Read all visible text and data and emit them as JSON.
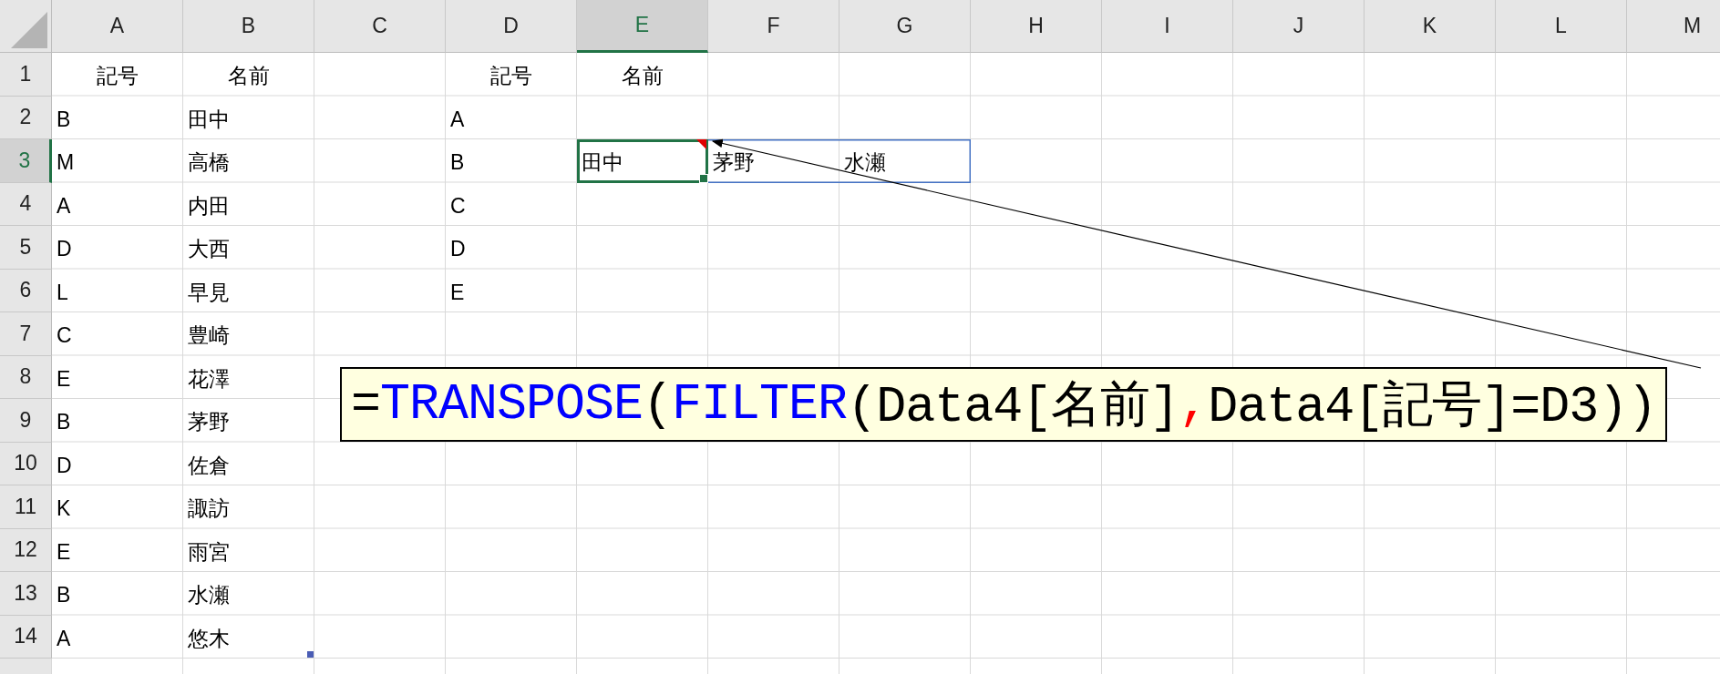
{
  "columns": [
    {
      "label": "A",
      "selected": false
    },
    {
      "label": "B",
      "selected": false
    },
    {
      "label": "C",
      "selected": false
    },
    {
      "label": "D",
      "selected": false
    },
    {
      "label": "E",
      "selected": true
    },
    {
      "label": "F",
      "selected": false
    },
    {
      "label": "G",
      "selected": false
    },
    {
      "label": "H",
      "selected": false
    },
    {
      "label": "I",
      "selected": false
    },
    {
      "label": "J",
      "selected": false
    },
    {
      "label": "K",
      "selected": false
    },
    {
      "label": "L",
      "selected": false
    },
    {
      "label": "M",
      "selected": false
    }
  ],
  "rows": [
    {
      "label": "1",
      "selected": false,
      "cells": [
        {
          "text": "記号",
          "centered": true,
          "selected": false
        },
        {
          "text": "名前",
          "centered": true,
          "selected": false
        },
        null,
        {
          "text": "記号",
          "centered": true,
          "selected": false
        },
        {
          "text": "名前",
          "centered": true,
          "selected": false
        }
      ]
    },
    {
      "label": "2",
      "selected": false,
      "cells": [
        {
          "text": "B",
          "selected": false
        },
        {
          "text": "田中",
          "selected": false
        },
        null,
        {
          "text": "A",
          "selected": false
        }
      ]
    },
    {
      "label": "3",
      "selected": true,
      "cells": [
        {
          "text": "M",
          "selected": false
        },
        {
          "text": "高橋",
          "selected": false
        },
        null,
        {
          "text": "B",
          "selected": false
        },
        {
          "text": "田中",
          "selected": true,
          "comment": true
        },
        {
          "text": "茅野",
          "selected": false,
          "spill": true
        },
        {
          "text": "水瀬",
          "selected": false,
          "spill": true
        }
      ]
    },
    {
      "label": "4",
      "selected": false,
      "cells": [
        {
          "text": "A",
          "selected": false
        },
        {
          "text": "内田",
          "selected": false
        },
        null,
        {
          "text": "C",
          "selected": false
        }
      ]
    },
    {
      "label": "5",
      "selected": false,
      "cells": [
        {
          "text": "D",
          "selected": false
        },
        {
          "text": "大西",
          "selected": false
        },
        null,
        {
          "text": "D",
          "selected": false
        }
      ]
    },
    {
      "label": "6",
      "selected": false,
      "cells": [
        {
          "text": "L",
          "selected": false
        },
        {
          "text": "早見",
          "selected": false
        },
        null,
        {
          "text": "E",
          "selected": false
        }
      ]
    },
    {
      "label": "7",
      "selected": false,
      "cells": [
        {
          "text": "C",
          "selected": false
        },
        {
          "text": "豊崎",
          "selected": false
        }
      ]
    },
    {
      "label": "8",
      "selected": false,
      "cells": [
        {
          "text": "E",
          "selected": false
        },
        {
          "text": "花澤",
          "selected": false
        }
      ]
    },
    {
      "label": "9",
      "selected": false,
      "cells": [
        {
          "text": "B",
          "selected": false
        },
        {
          "text": "茅野",
          "selected": false
        }
      ]
    },
    {
      "label": "10",
      "selected": false,
      "cells": [
        {
          "text": "D",
          "selected": false
        },
        {
          "text": "佐倉",
          "selected": false
        }
      ]
    },
    {
      "label": "11",
      "selected": false,
      "cells": [
        {
          "text": "K",
          "selected": false
        },
        {
          "text": "諏訪",
          "selected": false
        }
      ]
    },
    {
      "label": "12",
      "selected": false,
      "cells": [
        {
          "text": "E",
          "selected": false
        },
        {
          "text": "雨宮",
          "selected": false
        }
      ]
    },
    {
      "label": "13",
      "selected": false,
      "cells": [
        {
          "text": "B",
          "selected": false
        },
        {
          "text": "水瀬",
          "selected": false
        }
      ]
    },
    {
      "label": "14",
      "selected": false,
      "cells": [
        {
          "text": "A",
          "selected": false
        },
        {
          "text": "悠木",
          "selected": false,
          "table_end": true
        }
      ]
    }
  ],
  "callout": {
    "parts": [
      {
        "text": "=",
        "kind": "plain"
      },
      {
        "text": "TRANSPOSE",
        "kind": "function"
      },
      {
        "text": "(",
        "kind": "plain"
      },
      {
        "text": "FILTER",
        "kind": "function"
      },
      {
        "text": "(Data4[名前]",
        "kind": "plain"
      },
      {
        "text": ",",
        "kind": "separator"
      },
      {
        "text": "Data4[記号]=D3))",
        "kind": "plain"
      }
    ]
  }
}
